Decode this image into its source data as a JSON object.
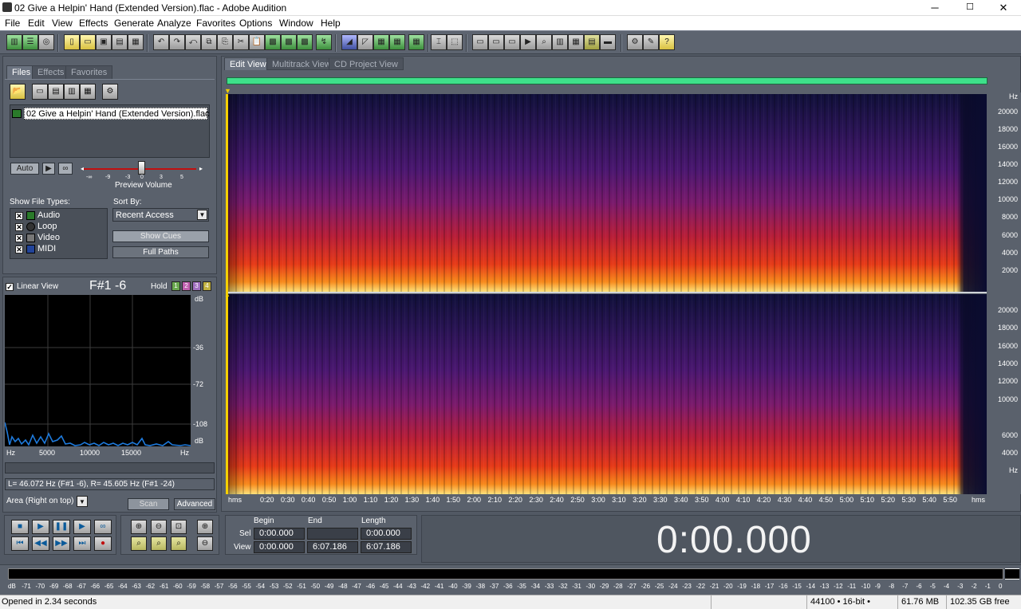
{
  "window": {
    "title": "02 Give a Helpin' Hand (Extended Version).flac - Adobe Audition",
    "min": "─",
    "max": "☐",
    "close": "✕"
  },
  "menu": [
    "File",
    "Edit",
    "View",
    "Effects",
    "Generate",
    "Analyze",
    "Favorites",
    "Options",
    "Window",
    "Help"
  ],
  "left_tabs": [
    "Files",
    "Effects",
    "Favorites"
  ],
  "files": {
    "item": "02 Give a Helpin' Hand (Extended Version).flac",
    "auto_label": "Auto",
    "slider_ticks": [
      "-∞",
      "-9",
      "-3",
      "0",
      "3",
      "5"
    ],
    "preview_volume_label": "Preview Volume",
    "show_file_types_label": "Show File Types:",
    "file_types": [
      "Audio",
      "Loop",
      "Video",
      "MIDI"
    ],
    "sort_by_label": "Sort By:",
    "sort_value": "Recent Access",
    "show_cues_label": "Show Cues",
    "full_paths_label": "Full Paths"
  },
  "analysis": {
    "linear_view_label": "Linear View",
    "note": "F#1 -6",
    "hold_label": "Hold",
    "hold_slots": [
      "1",
      "2",
      "3",
      "4"
    ],
    "db_labels": [
      "dB",
      "-36",
      "-72",
      "-108",
      "dB"
    ],
    "freq_ticks": [
      "Hz",
      "5000",
      "10000",
      "15000",
      "Hz"
    ],
    "readout": "L= 46.072 Hz (F#1 -6), R= 45.605 Hz (F#1 -24)",
    "area_value": "Area (Right on top)",
    "scan_label": "Scan",
    "advanced_label": "Advanced"
  },
  "editor_tabs": [
    "Edit View",
    "Multitrack View",
    "CD Project View"
  ],
  "hz_axis": [
    "Hz",
    "20000",
    "18000",
    "16000",
    "14000",
    "12000",
    "10000",
    "8000",
    "6000",
    "4000",
    "2000",
    "Hz"
  ],
  "time_axis": {
    "unit": "hms",
    "ticks": [
      "0:20",
      "0:30",
      "0:40",
      "0:50",
      "1:00",
      "1:10",
      "1:20",
      "1:30",
      "1:40",
      "1:50",
      "2:00",
      "2:10",
      "2:20",
      "2:30",
      "2:40",
      "2:50",
      "3:00",
      "3:10",
      "3:20",
      "3:30",
      "3:40",
      "3:50",
      "4:00",
      "4:10",
      "4:20",
      "4:30",
      "4:40",
      "4:50",
      "5:00",
      "5:10",
      "5:20",
      "5:30",
      "5:40",
      "5:50"
    ]
  },
  "selection": {
    "begin_label": "Begin",
    "end_label": "End",
    "length_label": "Length",
    "sel_label": "Sel",
    "view_label": "View",
    "sel_begin": "0:00.000",
    "sel_end": "",
    "sel_length": "0:00.000",
    "view_begin": "0:00.000",
    "view_end": "6:07.186",
    "view_length": "6:07.186"
  },
  "time_display": "0:00.000",
  "meter_ticks": [
    "dB",
    "-71",
    "-70",
    "-69",
    "-68",
    "-67",
    "-66",
    "-65",
    "-64",
    "-63",
    "-62",
    "-61",
    "-60",
    "-59",
    "-58",
    "-57",
    "-56",
    "-55",
    "-54",
    "-53",
    "-52",
    "-51",
    "-50",
    "-49",
    "-48",
    "-47",
    "-46",
    "-45",
    "-44",
    "-43",
    "-42",
    "-41",
    "-40",
    "-39",
    "-38",
    "-37",
    "-36",
    "-35",
    "-34",
    "-33",
    "-32",
    "-31",
    "-30",
    "-29",
    "-28",
    "-27",
    "-26",
    "-25",
    "-24",
    "-23",
    "-22",
    "-21",
    "-20",
    "-19",
    "-18",
    "-17",
    "-16",
    "-15",
    "-14",
    "-13",
    "-12",
    "-11",
    "-10",
    "-9",
    "-8",
    "-7",
    "-6",
    "-5",
    "-4",
    "-3",
    "-2",
    "-1",
    "0"
  ],
  "status": {
    "message": "Opened in 2.34 seconds",
    "format": "44100 • 16-bit • Stereo",
    "size": "61.76 MB",
    "free": "102.35 GB free"
  }
}
